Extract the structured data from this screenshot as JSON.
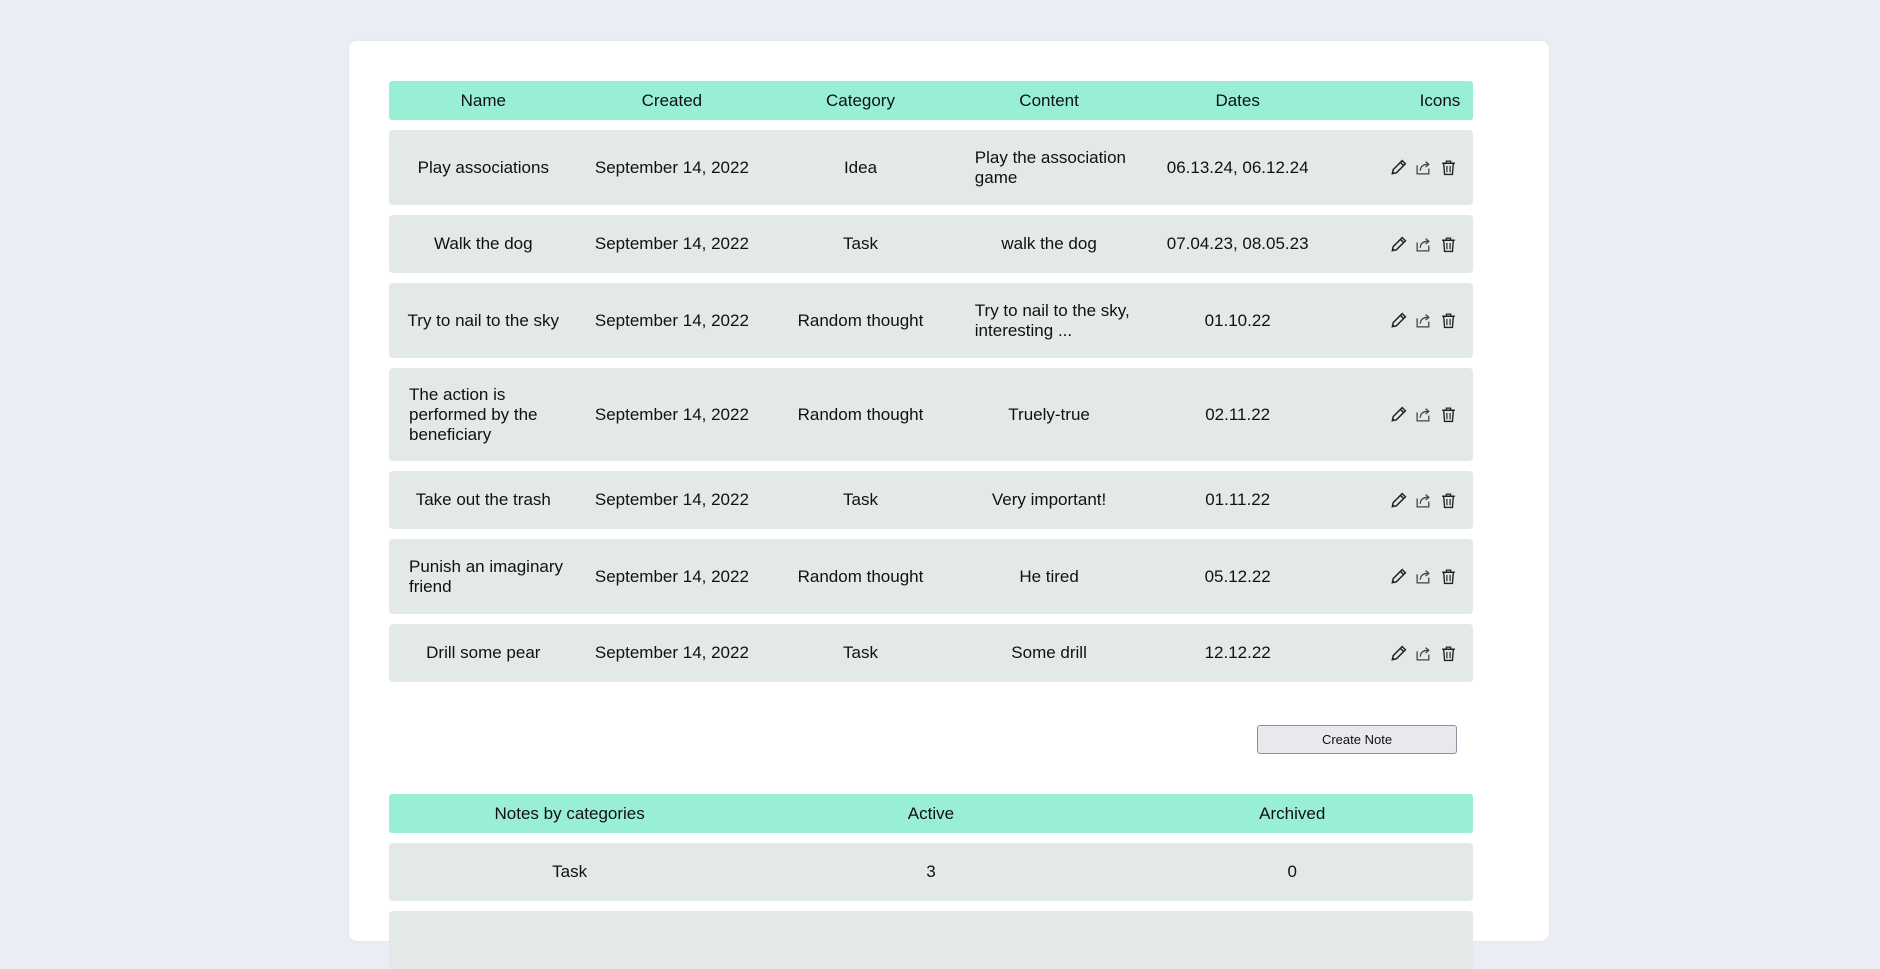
{
  "notes_table": {
    "headers": [
      "Name",
      "Created",
      "Category",
      "Content",
      "Dates",
      "Icons"
    ],
    "rows": [
      {
        "name": "Play associations",
        "created": "September 14, 2022",
        "category": "Idea",
        "content": "Play the association game",
        "dates": "06.13.24, 06.12.24"
      },
      {
        "name": "Walk the dog",
        "created": "September 14, 2022",
        "category": "Task",
        "content": "walk the dog",
        "dates": "07.04.23, 08.05.23"
      },
      {
        "name": "Try to nail to the sky",
        "created": "September 14, 2022",
        "category": "Random thought",
        "content": "Try to nail to the sky, interesting ...",
        "dates": "01.10.22"
      },
      {
        "name": "The action is performed by the beneficiary",
        "created": "September 14, 2022",
        "category": "Random thought",
        "content": "Truely-true",
        "dates": "02.11.22"
      },
      {
        "name": "Take out the trash",
        "created": "September 14, 2022",
        "category": "Task",
        "content": "Very important!",
        "dates": "01.11.22"
      },
      {
        "name": "Punish an imaginary friend",
        "created": "September 14, 2022",
        "category": "Random thought",
        "content": "He tired",
        "dates": "05.12.22"
      },
      {
        "name": "Drill some pear",
        "created": "September 14, 2022",
        "category": "Task",
        "content": "Some drill",
        "dates": "12.12.22"
      }
    ],
    "row_icons": [
      "pencil-icon",
      "archive-icon",
      "trash-icon"
    ]
  },
  "create_button": {
    "label": "Create Note"
  },
  "summary_table": {
    "headers": [
      "Notes by categories",
      "Active",
      "Archived"
    ],
    "rows": [
      {
        "category": "Task",
        "active": "3",
        "archived": "0"
      },
      {
        "category": "",
        "active": "",
        "archived": ""
      }
    ]
  },
  "colors": {
    "background": "#eaeef4",
    "header": "#98efd6",
    "row": "#e3e9e7",
    "card": "#ffffff"
  }
}
